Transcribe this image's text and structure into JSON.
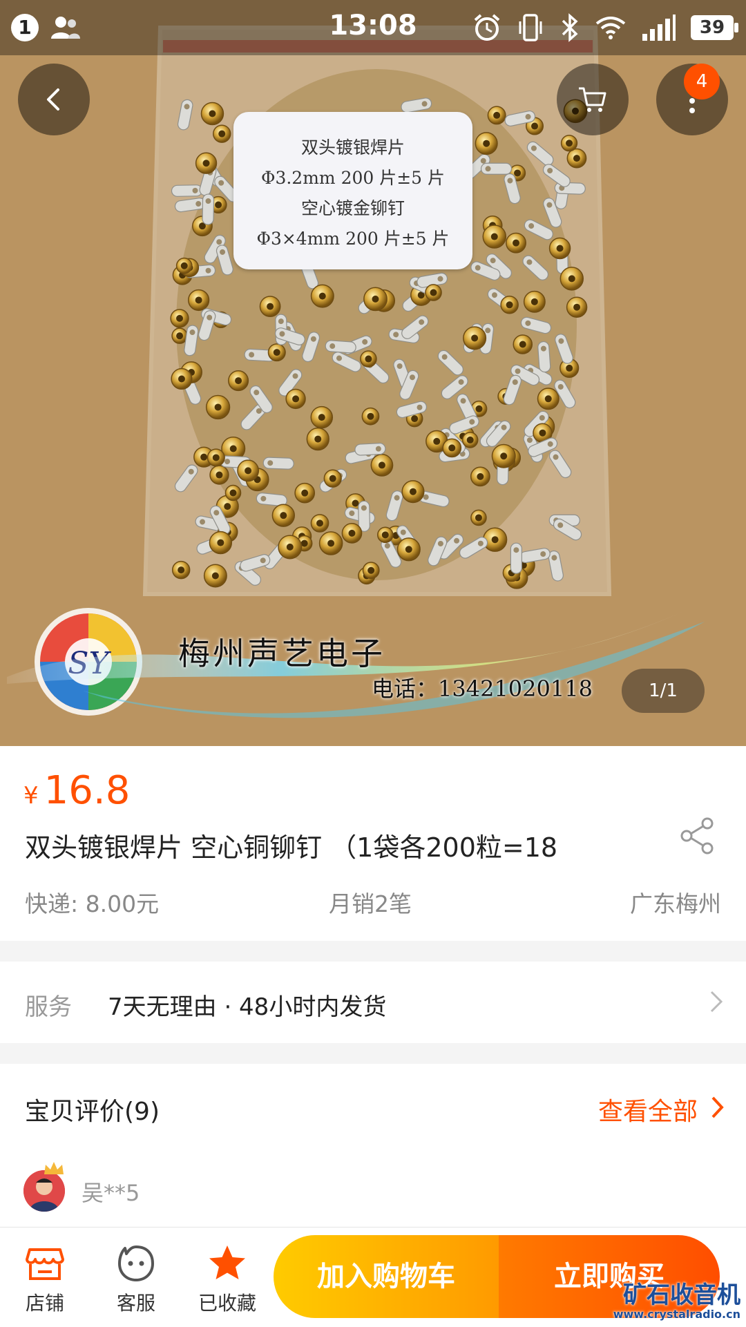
{
  "status_bar": {
    "notification_count": "1",
    "time": "13:08",
    "battery": "39"
  },
  "gallery": {
    "cart_badge": "4",
    "pager": "1/1",
    "label_lines": [
      "双头镀银焊片",
      "Φ3.2mm 200 片±5 片",
      "空心镀金铆钉",
      "Φ3×4mm 200 片±5 片"
    ],
    "watermark_brand": "梅州声艺电子",
    "watermark_phone": "电话：13421020118"
  },
  "product": {
    "currency": "¥",
    "price": "16.8",
    "title": "双头镀银焊片 空心铜铆钉 （1袋各200粒=18",
    "shipping": "快递: 8.00元",
    "monthly_sales": "月销2笔",
    "location": "广东梅州"
  },
  "service": {
    "label": "服务",
    "text": "7天无理由 · 48小时内发货"
  },
  "reviews": {
    "header": "宝贝评价(9)",
    "view_all": "查看全部",
    "first_reviewer": "吴**5"
  },
  "bottom_bar": {
    "shop_label": "店铺",
    "service_label": "客服",
    "favorite_label": "已收藏",
    "add_to_cart": "加入购物车",
    "buy_now": "立即购买"
  },
  "site_watermark": {
    "name": "矿石收音机",
    "url": "www.crystalradio.cn"
  },
  "colors": {
    "accent": "#ff5000",
    "cart_button": "#ffa800",
    "buy_button": "#ff5a00"
  }
}
